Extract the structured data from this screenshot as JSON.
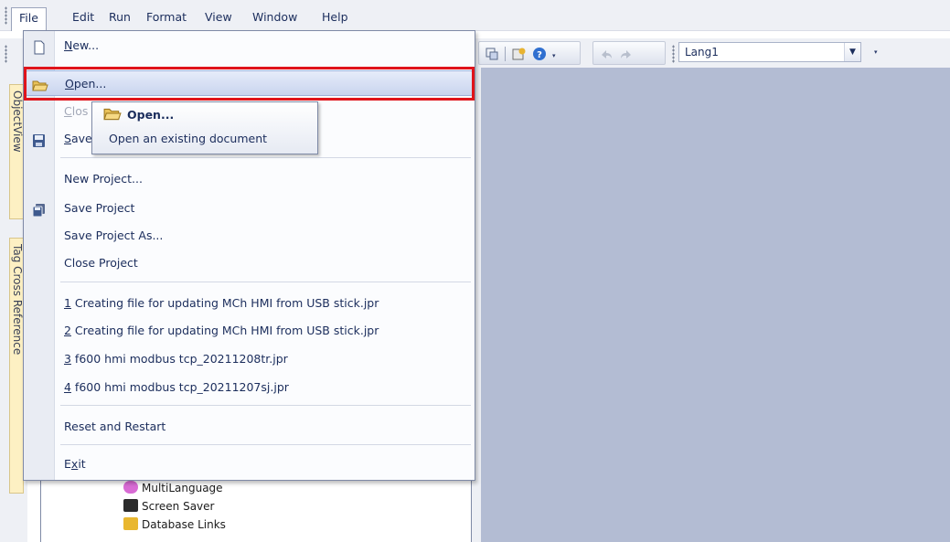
{
  "menubar": {
    "items": [
      "File",
      "Edit",
      "Run",
      "Format",
      "View",
      "Window",
      "Help"
    ],
    "active": "File"
  },
  "toolbar": {
    "language_value": "Lang1"
  },
  "side_tabs": {
    "object_view": "ObjectView",
    "tag_cross_reference": "Tag Cross Reference"
  },
  "tree": {
    "items": [
      "MultiLanguage",
      "Screen Saver",
      "Database Links"
    ]
  },
  "file_menu": {
    "new": {
      "accel": "N",
      "rest": "ew..."
    },
    "open": {
      "accel": "O",
      "rest": "pen..."
    },
    "close": {
      "accel": "C",
      "rest": "los"
    },
    "save": {
      "accel": "S",
      "rest": "ave"
    },
    "new_project": "New Project...",
    "save_project": "Save Project",
    "save_project_as": "Save Project As...",
    "close_project": "Close Project",
    "recent": [
      {
        "num": "1",
        "name": " Creating file for updating MCh HMI from USB stick.jpr"
      },
      {
        "num": "2",
        "name": " Creating file for updating MCh HMI from USB stick.jpr"
      },
      {
        "num": "3",
        "name": " f600 hmi modbus tcp_20211208tr.jpr"
      },
      {
        "num": "4",
        "name": " f600 hmi modbus tcp_20211207sj.jpr"
      }
    ],
    "reset_restart": "Reset and Restart",
    "exit": {
      "accel": "x",
      "pre": "E",
      "rest": "it"
    }
  },
  "tooltip": {
    "title": "Open...",
    "description": "Open an existing document"
  },
  "colors": {
    "highlight_border": "#e0141b",
    "workspace": "#b3bcd3",
    "menu_text": "#1b2d5c"
  }
}
